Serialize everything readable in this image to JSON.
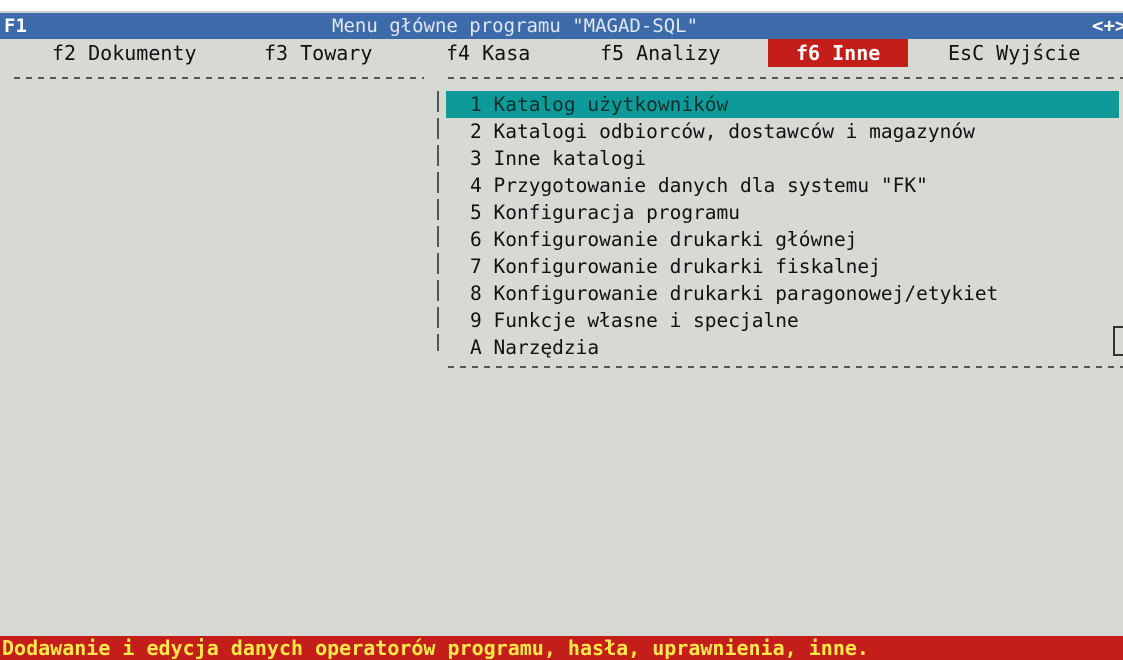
{
  "titlebar": {
    "left": "F1",
    "title": "Menu główne programu \"MAGAD-SQL\"",
    "right": "<+>"
  },
  "menubar": {
    "items": [
      {
        "key": "f2",
        "label": "f2 Dokumenty"
      },
      {
        "key": "f3",
        "label": "f3 Towary"
      },
      {
        "key": "f4",
        "label": "f4 Kasa"
      },
      {
        "key": "f5",
        "label": "f5 Analizy"
      },
      {
        "key": "f6",
        "label": "f6 Inne",
        "active": true
      },
      {
        "key": "esc",
        "label": "EsC Wyjście"
      }
    ]
  },
  "submenu": {
    "items": [
      {
        "label": "1 Katalog użytkowników",
        "selected": true
      },
      {
        "label": "2 Katalogi odbiorców, dostawców i magazynów"
      },
      {
        "label": "3 Inne katalogi"
      },
      {
        "label": "4 Przygotowanie danych dla systemu \"FK\""
      },
      {
        "label": "5 Konfiguracja programu"
      },
      {
        "label": "6 Konfigurowanie drukarki głównej"
      },
      {
        "label": "7 Konfigurowanie drukarki fiskalnej"
      },
      {
        "label": "8 Konfigurowanie drukarki paragonowej/etykiet"
      },
      {
        "label": "9 Funkcje własne i specjalne"
      },
      {
        "label": "A Narzędzia"
      }
    ]
  },
  "statusbar": {
    "text": "Dodawanie i edycja danych operatorów programu, hasła, uprawnienia, inne."
  },
  "colors": {
    "titlebar_bg": "#3d6aa8",
    "active_menu_bg": "#c41e1a",
    "highlight_bg": "#0e9a98",
    "status_bg": "#c41e1a",
    "status_text": "#ffe84a",
    "screen_bg": "#d8d8d5"
  }
}
